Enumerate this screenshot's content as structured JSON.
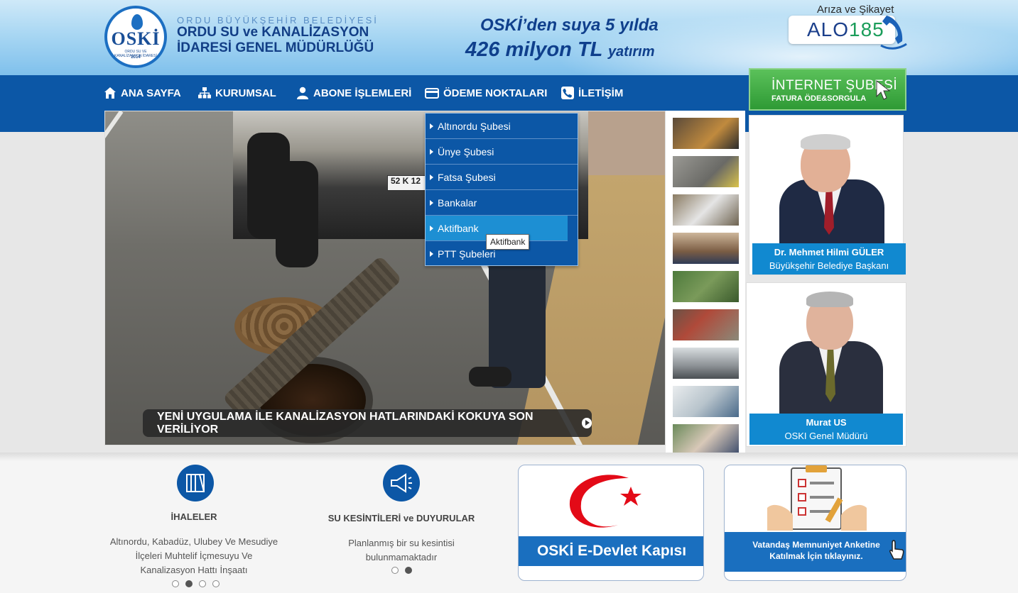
{
  "header": {
    "logo_text": "OSKİ",
    "logo_sub": "ORDU SU VE KANALİZASYON İDARESİ",
    "logo_year": "2014",
    "org_line1": "ORDU BÜYÜKŞEHİR BELEDİYESİ",
    "org_line2": "ORDU SU ve KANALİZASYON",
    "org_line3": "İDARESİ GENEL MÜDÜRLÜĞÜ",
    "slogan_line1": "OSKİ’den suya 5 yılda",
    "slogan_amount": "426 milyon TL",
    "slogan_suffix": "yatırım",
    "complaint_label": "Arıza ve Şikayet",
    "alo_word": "ALO",
    "alo_number": "185"
  },
  "nav": {
    "items": [
      {
        "label": "ANA SAYFA",
        "icon": "home-icon"
      },
      {
        "label": "KURUMSAL",
        "icon": "sitemap-icon"
      },
      {
        "label": "ABONE İŞLEMLERİ",
        "icon": "user-icon"
      },
      {
        "label": "ÖDEME NOKTALARI",
        "icon": "credit-card-icon"
      },
      {
        "label": "İLETİŞİM",
        "icon": "phone-icon"
      }
    ]
  },
  "internet_branch": {
    "title": "İNTERNET ŞUBESİ",
    "subtitle": "FATURA ÖDE&SORGULA"
  },
  "dropdown": {
    "items": [
      {
        "label": "Altınordu Şubesi",
        "active": false
      },
      {
        "label": "Ünye Şubesi",
        "active": false
      },
      {
        "label": "Fatsa Şubesi",
        "active": false
      },
      {
        "label": "Bankalar",
        "active": false
      },
      {
        "label": "Aktifbank",
        "active": true
      },
      {
        "label": "PTT Şubeleri",
        "active": false
      }
    ],
    "tooltip": "Aktifbank"
  },
  "slider": {
    "plate": "52 K 12",
    "caption": "YENİ UYGULAMA İLE KANALİZASYON HATLARINDAKİ KOKUYA SON VERİLİYOR"
  },
  "profiles": [
    {
      "name": "Dr. Mehmet Hilmi GÜLER",
      "role": "Büyükşehir Belediye Başkanı"
    },
    {
      "name": "Murat US",
      "role": "OSKI Genel Müdürü"
    }
  ],
  "bottom": {
    "tenders": {
      "title": "İHALELER",
      "text_lines": [
        "Altınordu, Kabadüz, Ulubey Ve Mesudiye",
        "İlçeleri Muhtelif İçmesuyu Ve",
        "Kanalizasyon Hattı İnşaatı"
      ]
    },
    "outages": {
      "title": "SU KESİNTİLERİ ve DUYURULAR",
      "text_lines": [
        "Planlanmış bir su kesintisi",
        "bulunmamaktadır"
      ]
    },
    "edevlet_label": "OSKİ E-Devlet Kapısı",
    "survey_lines": [
      "Vatandaş Memnuniyet Anketine",
      "Katılmak İçin tıklayınız."
    ]
  },
  "colors": {
    "nav_blue": "#0c57a6",
    "accent_blue": "#1189d0",
    "internet_green": "#2e9a35",
    "edevlet_red": "#e30a17"
  }
}
